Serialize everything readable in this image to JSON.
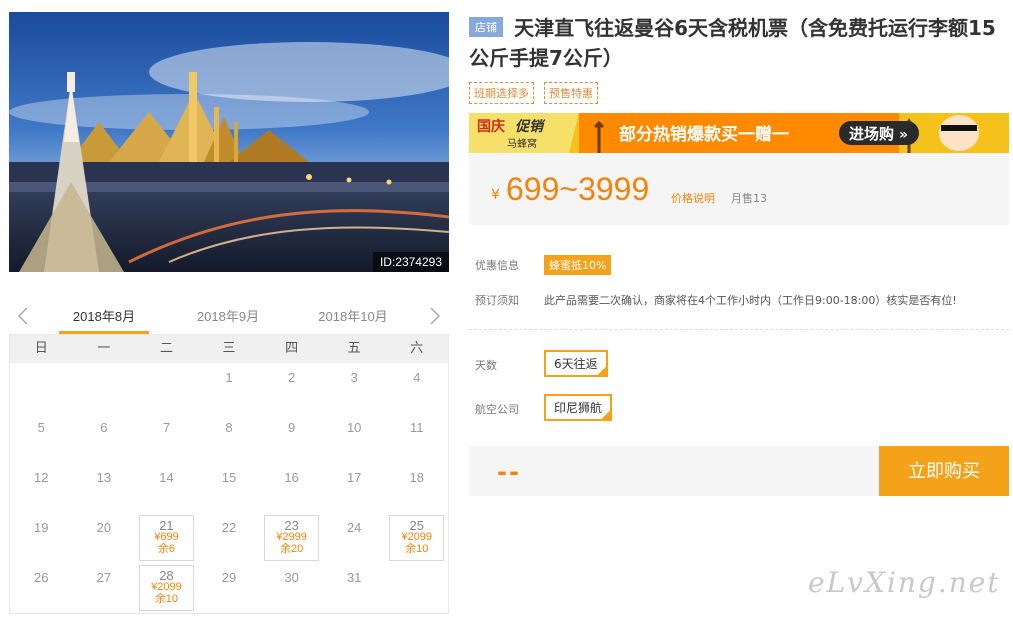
{
  "hero": {
    "id_label": "ID:2374293"
  },
  "calendar": {
    "months": [
      "2018年8月",
      "2018年9月",
      "2018年10月"
    ],
    "active_month": 0,
    "weekdays": [
      "日",
      "一",
      "二",
      "三",
      "四",
      "五",
      "六"
    ],
    "weeks": [
      [
        {
          "d": ""
        },
        {
          "d": ""
        },
        {
          "d": ""
        },
        {
          "d": "1"
        },
        {
          "d": "2"
        },
        {
          "d": "3"
        },
        {
          "d": "4"
        }
      ],
      [
        {
          "d": "5"
        },
        {
          "d": "6"
        },
        {
          "d": "7"
        },
        {
          "d": "8"
        },
        {
          "d": "9"
        },
        {
          "d": "10"
        },
        {
          "d": "11"
        }
      ],
      [
        {
          "d": "12"
        },
        {
          "d": "13"
        },
        {
          "d": "14"
        },
        {
          "d": "15"
        },
        {
          "d": "16"
        },
        {
          "d": "17"
        },
        {
          "d": "18"
        }
      ],
      [
        {
          "d": "19"
        },
        {
          "d": "20"
        },
        {
          "d": "21",
          "price": "¥699",
          "remain": "余6"
        },
        {
          "d": "22"
        },
        {
          "d": "23",
          "price": "¥2999",
          "remain": "余20"
        },
        {
          "d": "24"
        },
        {
          "d": "25",
          "price": "¥2099",
          "remain": "余10"
        }
      ],
      [
        {
          "d": "26"
        },
        {
          "d": "27"
        },
        {
          "d": "28",
          "price": "¥2099",
          "remain": "余10"
        },
        {
          "d": "29"
        },
        {
          "d": "30"
        },
        {
          "d": "31"
        },
        {
          "d": ""
        }
      ]
    ]
  },
  "product": {
    "shop_badge": "店铺",
    "title": "天津直飞往返曼谷6天含税机票（含免费托运行李额15公斤手提7公斤）",
    "tags": [
      "班期选择多",
      "预售特惠"
    ]
  },
  "banner": {
    "logo_line1": "国庆",
    "logo_line2": "促销",
    "logo_brand": "马蜂窝",
    "slogan": "部分热销爆款买一赠一",
    "cta": "进场购"
  },
  "price": {
    "currency": "¥",
    "range": "699~3999",
    "note": "价格说明",
    "monthly_sales": "月售13"
  },
  "info": {
    "promo_label": "优惠信息",
    "promo_badge": "蜂蜜抵10%",
    "booking_label": "预订须知",
    "booking_text": "此产品需要二次确认，商家将在4个工作小时内（工作日9:00-18:00）核实是否有位!"
  },
  "options": {
    "days_label": "天数",
    "days_value": "6天往返",
    "airline_label": "航空公司",
    "airline_value": "印尼狮航"
  },
  "buy": {
    "price_placeholder": "--",
    "button": "立即购买"
  },
  "watermark": "eLvXing.net",
  "colors": {
    "accent": "#f5a21b",
    "price": "#f5820a",
    "badge": "#86a8da"
  }
}
